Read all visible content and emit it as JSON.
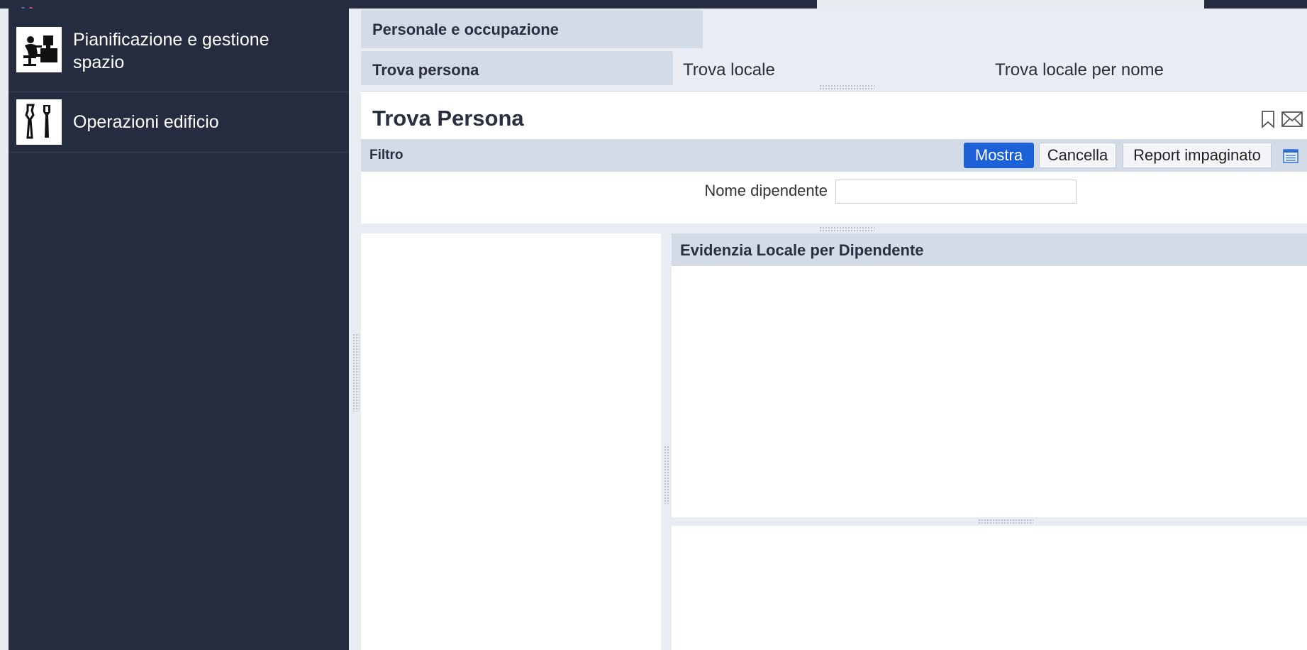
{
  "sidebar": {
    "items": [
      {
        "label": "Pianificazione e gestione spazio",
        "icon": "office-desk-icon"
      },
      {
        "label": "Operazioni edificio",
        "icon": "tools-icon"
      }
    ]
  },
  "process_tab": {
    "label": "Personale e occupazione"
  },
  "tasks": [
    {
      "label": "Trova persona",
      "active": true
    },
    {
      "label": "Trova locale",
      "active": false
    },
    {
      "label": "Trova locale per nome",
      "active": false
    }
  ],
  "panel": {
    "title": "Trova Persona",
    "filter_label": "Filtro",
    "buttons": {
      "show": "Mostra",
      "clear": "Cancella",
      "paginated_report": "Report impaginato"
    },
    "field_label": "Nome dipendente",
    "field_value": ""
  },
  "right_panel": {
    "title": "Evidenzia Locale per Dipendente"
  },
  "colors": {
    "sidebar_bg": "#262c40",
    "accent": "#1c61d8",
    "header_bg": "#d3dbe7"
  }
}
